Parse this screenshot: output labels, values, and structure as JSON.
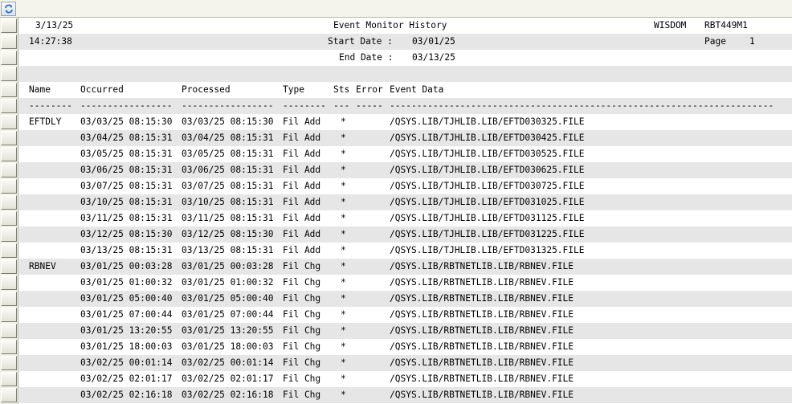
{
  "header": {
    "date": "3/13/25",
    "title": "Event Monitor History",
    "system": "WISDOM",
    "program": "RBT449M1",
    "time": "14:27:38",
    "start_date_label": "Start Date :",
    "start_date": "03/01/25",
    "page_label": "Page",
    "page_number": "1",
    "end_date_label": "End Date :",
    "end_date": "03/13/25"
  },
  "columns": {
    "name": "Name",
    "occurred": "Occurred",
    "processed": "Processed",
    "type": "Type",
    "sts": "Sts",
    "error": "Error",
    "event_data": "Event Data"
  },
  "separator": {
    "name": "--------",
    "occurred": "-----------------",
    "processed": "-----------------",
    "type": "--------",
    "sts": "---",
    "error": "-----",
    "event_data": "-----------------------------------------------------------------------"
  },
  "rows": [
    {
      "name": "EFTDLY",
      "occurred": "03/03/25 08:15:30",
      "processed": "03/03/25 08:15:30",
      "type": "Fil Add",
      "sts": "*",
      "error": "",
      "event_data": "/QSYS.LIB/TJHLIB.LIB/EFTD030325.FILE"
    },
    {
      "name": "",
      "occurred": "03/04/25 08:15:31",
      "processed": "03/04/25 08:15:31",
      "type": "Fil Add",
      "sts": "*",
      "error": "",
      "event_data": "/QSYS.LIB/TJHLIB.LIB/EFTD030425.FILE"
    },
    {
      "name": "",
      "occurred": "03/05/25 08:15:31",
      "processed": "03/05/25 08:15:31",
      "type": "Fil Add",
      "sts": "*",
      "error": "",
      "event_data": "/QSYS.LIB/TJHLIB.LIB/EFTD030525.FILE"
    },
    {
      "name": "",
      "occurred": "03/06/25 08:15:31",
      "processed": "03/06/25 08:15:31",
      "type": "Fil Add",
      "sts": "*",
      "error": "",
      "event_data": "/QSYS.LIB/TJHLIB.LIB/EFTD030625.FILE"
    },
    {
      "name": "",
      "occurred": "03/07/25 08:15:31",
      "processed": "03/07/25 08:15:31",
      "type": "Fil Add",
      "sts": "*",
      "error": "",
      "event_data": "/QSYS.LIB/TJHLIB.LIB/EFTD030725.FILE"
    },
    {
      "name": "",
      "occurred": "03/10/25 08:15:31",
      "processed": "03/10/25 08:15:31",
      "type": "Fil Add",
      "sts": "*",
      "error": "",
      "event_data": "/QSYS.LIB/TJHLIB.LIB/EFTD031025.FILE"
    },
    {
      "name": "",
      "occurred": "03/11/25 08:15:31",
      "processed": "03/11/25 08:15:31",
      "type": "Fil Add",
      "sts": "*",
      "error": "",
      "event_data": "/QSYS.LIB/TJHLIB.LIB/EFTD031125.FILE"
    },
    {
      "name": "",
      "occurred": "03/12/25 08:15:30",
      "processed": "03/12/25 08:15:30",
      "type": "Fil Add",
      "sts": "*",
      "error": "",
      "event_data": "/QSYS.LIB/TJHLIB.LIB/EFTD031225.FILE"
    },
    {
      "name": "",
      "occurred": "03/13/25 08:15:31",
      "processed": "03/13/25 08:15:31",
      "type": "Fil Add",
      "sts": "*",
      "error": "",
      "event_data": "/QSYS.LIB/TJHLIB.LIB/EFTD031325.FILE"
    },
    {
      "name": "RBNEV",
      "occurred": "03/01/25 00:03:28",
      "processed": "03/01/25 00:03:28",
      "type": "Fil Chg",
      "sts": "*",
      "error": "",
      "event_data": "/QSYS.LIB/RBTNETLIB.LIB/RBNEV.FILE"
    },
    {
      "name": "",
      "occurred": "03/01/25 01:00:32",
      "processed": "03/01/25 01:00:32",
      "type": "Fil Chg",
      "sts": "*",
      "error": "",
      "event_data": "/QSYS.LIB/RBTNETLIB.LIB/RBNEV.FILE"
    },
    {
      "name": "",
      "occurred": "03/01/25 05:00:40",
      "processed": "03/01/25 05:00:40",
      "type": "Fil Chg",
      "sts": "*",
      "error": "",
      "event_data": "/QSYS.LIB/RBTNETLIB.LIB/RBNEV.FILE"
    },
    {
      "name": "",
      "occurred": "03/01/25 07:00:44",
      "processed": "03/01/25 07:00:44",
      "type": "Fil Chg",
      "sts": "*",
      "error": "",
      "event_data": "/QSYS.LIB/RBTNETLIB.LIB/RBNEV.FILE"
    },
    {
      "name": "",
      "occurred": "03/01/25 13:20:55",
      "processed": "03/01/25 13:20:55",
      "type": "Fil Chg",
      "sts": "*",
      "error": "",
      "event_data": "/QSYS.LIB/RBTNETLIB.LIB/RBNEV.FILE"
    },
    {
      "name": "",
      "occurred": "03/01/25 18:00:03",
      "processed": "03/01/25 18:00:03",
      "type": "Fil Chg",
      "sts": "*",
      "error": "",
      "event_data": "/QSYS.LIB/RBTNETLIB.LIB/RBNEV.FILE"
    },
    {
      "name": "",
      "occurred": "03/02/25 00:01:14",
      "processed": "03/02/25 00:01:14",
      "type": "Fil Chg",
      "sts": "*",
      "error": "",
      "event_data": "/QSYS.LIB/RBTNETLIB.LIB/RBNEV.FILE"
    },
    {
      "name": "",
      "occurred": "03/02/25 02:01:17",
      "processed": "03/02/25 02:01:17",
      "type": "Fil Chg",
      "sts": "*",
      "error": "",
      "event_data": "/QSYS.LIB/RBTNETLIB.LIB/RBNEV.FILE"
    },
    {
      "name": "",
      "occurred": "03/02/25 02:16:18",
      "processed": "03/02/25 02:16:18",
      "type": "Fil Chg",
      "sts": "*",
      "error": "",
      "event_data": "/QSYS.LIB/RBTNETLIB.LIB/RBNEV.FILE"
    }
  ]
}
